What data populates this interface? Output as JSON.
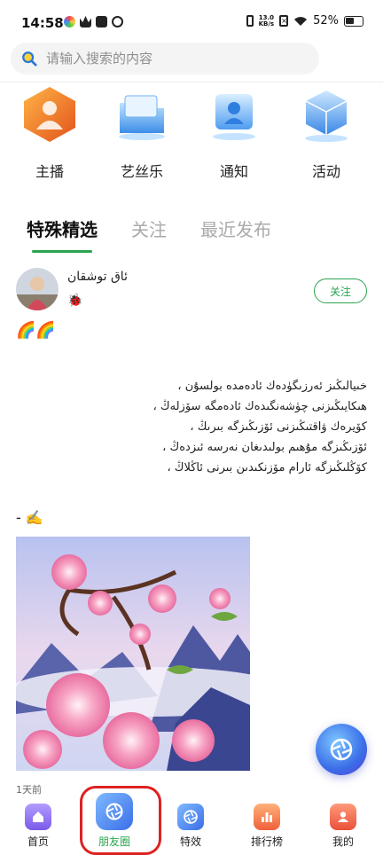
{
  "status_bar": {
    "time": "14:58",
    "net_speed_value": "13.0",
    "net_speed_unit": "KB/s",
    "battery": "52%"
  },
  "search": {
    "placeholder": "请输入搜索的内容"
  },
  "categories": [
    {
      "label": "主播",
      "icon": "anchor-icon"
    },
    {
      "label": "艺丝乐",
      "icon": "folder-icon"
    },
    {
      "label": "通知",
      "icon": "notification-icon"
    },
    {
      "label": "活动",
      "icon": "activity-icon"
    }
  ],
  "tabs": [
    {
      "label": "特殊精选",
      "active": true
    },
    {
      "label": "关注",
      "active": false
    },
    {
      "label": "最近发布",
      "active": false
    }
  ],
  "post": {
    "username": "ئاق توشقان",
    "badge": "🐞",
    "follow_label": "关注",
    "emoji_line": "🌈🌈",
    "lines": [
      "خىيالىڭىز ئەرزىگۈدەك ئادەمدە بولسۇن ،",
      "ھىكايىڭىزنى چۈشەنگىدەك ئادەمگە سۆزلەڭ ،",
      "كۆيرەك ۋاقتىڭىزنى ئۆزىڭىزگە بىرىڭ ،",
      "ئۆزىڭىزگە مۇھىم بولىدىغان نەرسە ئىزدەڭ ،",
      "كۆڭلىڭىزگە ئارام مۆزنكىدىن بىرنى ئاڭلاڭ ،"
    ],
    "signature": "- ✍️",
    "time_ago": "1天前"
  },
  "bottom_nav": [
    {
      "label": "首页",
      "icon": "home-icon",
      "color": "#8a6cf0",
      "active": false
    },
    {
      "label": "朋友圈",
      "icon": "camera-icon",
      "color": "#4a8df0",
      "active": true
    },
    {
      "label": "特效",
      "icon": "effects-icon",
      "color": "#4a8df0",
      "active": false
    },
    {
      "label": "排行榜",
      "icon": "ranking-icon",
      "color": "#f0783a",
      "active": false
    },
    {
      "label": "我的",
      "icon": "profile-icon",
      "color": "#f06a4a",
      "active": false
    }
  ],
  "colors": {
    "accent": "#2aa44f",
    "highlight": "#dd2222"
  }
}
